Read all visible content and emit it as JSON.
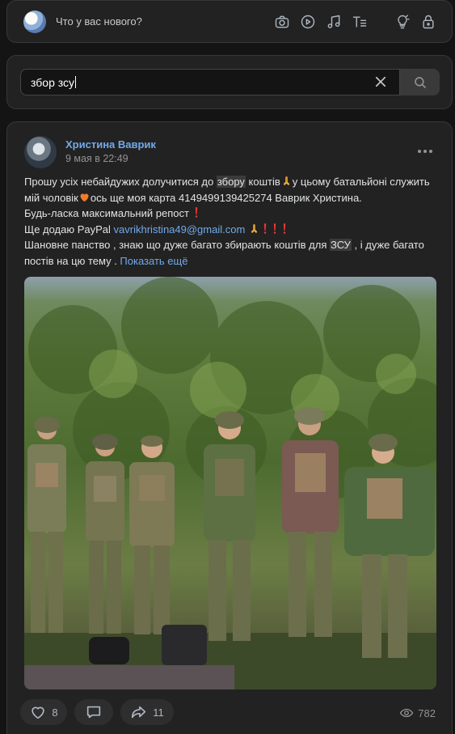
{
  "composer": {
    "placeholder": "Что у вас нового?",
    "tools": [
      "camera-icon",
      "video-icon",
      "music-icon",
      "text-format-icon",
      "bulb-icon",
      "lock-icon"
    ]
  },
  "search": {
    "value": "збор зсу"
  },
  "post": {
    "author": "Христина Ваврик",
    "date": "9 мая в 22:49",
    "text": {
      "l1_a": "Прошу усіх небайдужих долучитися до ",
      "l1_hl": "збору",
      "l1_b": " коштів",
      "l1_c": "у цьому батальйоні служить мій чоловік",
      "l1_d": "ось ще моя карта 4149499139425274 Ваврик Христина.",
      "l2": "Будь-ласка максимальний репост",
      "l3_a": "Ще додаю PayPal ",
      "l3_link": "vavrikhristina49@gmail.com",
      "l4_a": "Шановне панство , знаю що дуже багато збирають коштів для ",
      "l4_hl": "ЗСУ",
      "l4_b": " , і дуже багато постів на цю тему . ",
      "show_more": "Показать ещё"
    },
    "likes": "8",
    "reposts": "11",
    "views": "782"
  }
}
